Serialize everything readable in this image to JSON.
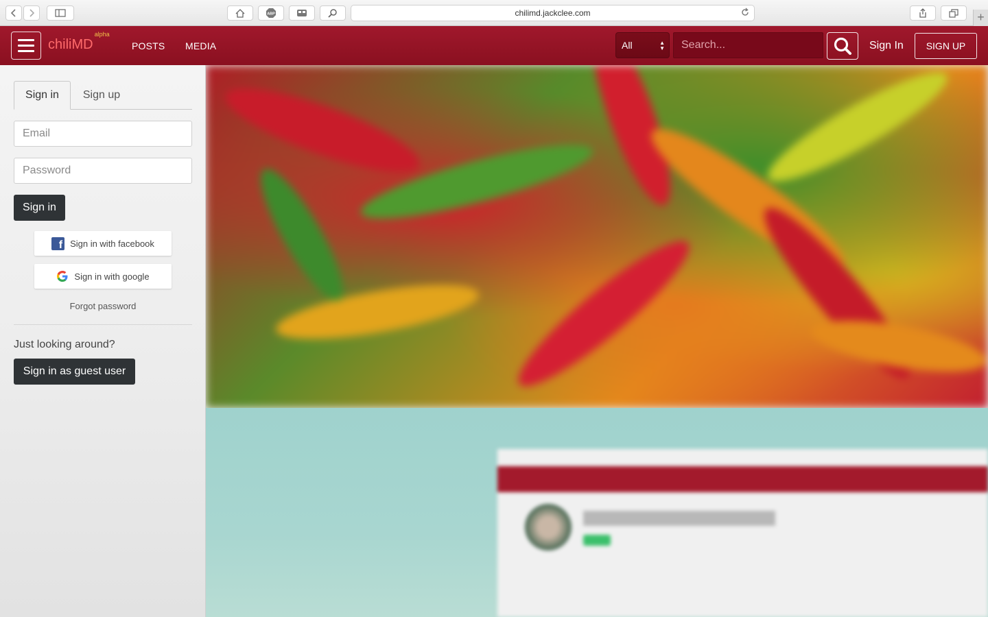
{
  "browser": {
    "url": "chilimd.jackclee.com"
  },
  "navbar": {
    "brand": "chiliMD",
    "brand_badge": "alpha",
    "links": [
      "POSTS",
      "MEDIA"
    ],
    "filter_value": "All",
    "search_placeholder": "Search...",
    "signin_label": "Sign In",
    "signup_label": "SIGN UP",
    "colors": {
      "bar": "#a0182c",
      "brand": "#ff6b6b"
    }
  },
  "sidebar": {
    "tabs": [
      "Sign in",
      "Sign up"
    ],
    "active_tab": "Sign in",
    "email_placeholder": "Email",
    "password_placeholder": "Password",
    "signin_button": "Sign in",
    "facebook_button": "Sign in with facebook",
    "google_button": "Sign in with google",
    "forgot_password": "Forgot password",
    "looking_text": "Just looking around?",
    "guest_button": "Sign in as guest user"
  },
  "icons": {
    "menu": "hamburger-icon",
    "search": "search-icon",
    "facebook": "facebook-icon",
    "google": "google-icon"
  }
}
